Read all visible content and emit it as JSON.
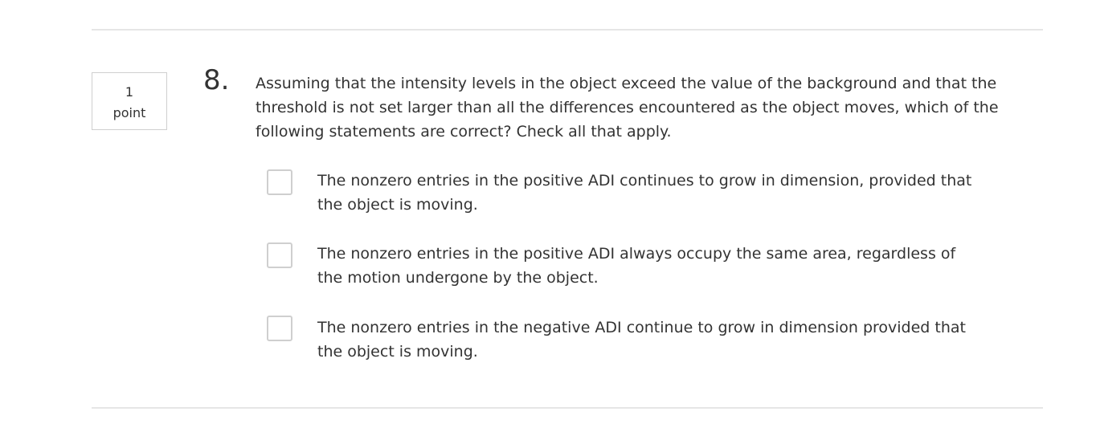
{
  "question": {
    "points_value": "1",
    "points_unit": "point",
    "number": "8.",
    "prompt": "Assuming that the intensity levels in the object exceed the value of the background and that the threshold is not set larger than all the differences encountered as the object moves, which of the following statements are correct? Check all that apply.",
    "options": [
      {
        "label": "The nonzero entries in the positive ADI continues to grow in dimension, provided that the object is moving.",
        "checked": false
      },
      {
        "label": "The nonzero entries in the positive ADI always occupy the same area, regardless of the motion undergone by the object.",
        "checked": false
      },
      {
        "label": "The nonzero entries in the negative ADI continue to grow in dimension provided that the object is moving.",
        "checked": false
      }
    ]
  },
  "colors": {
    "text": "#333333",
    "divider": "#e6e6e6",
    "border": "#cfcfcf"
  }
}
